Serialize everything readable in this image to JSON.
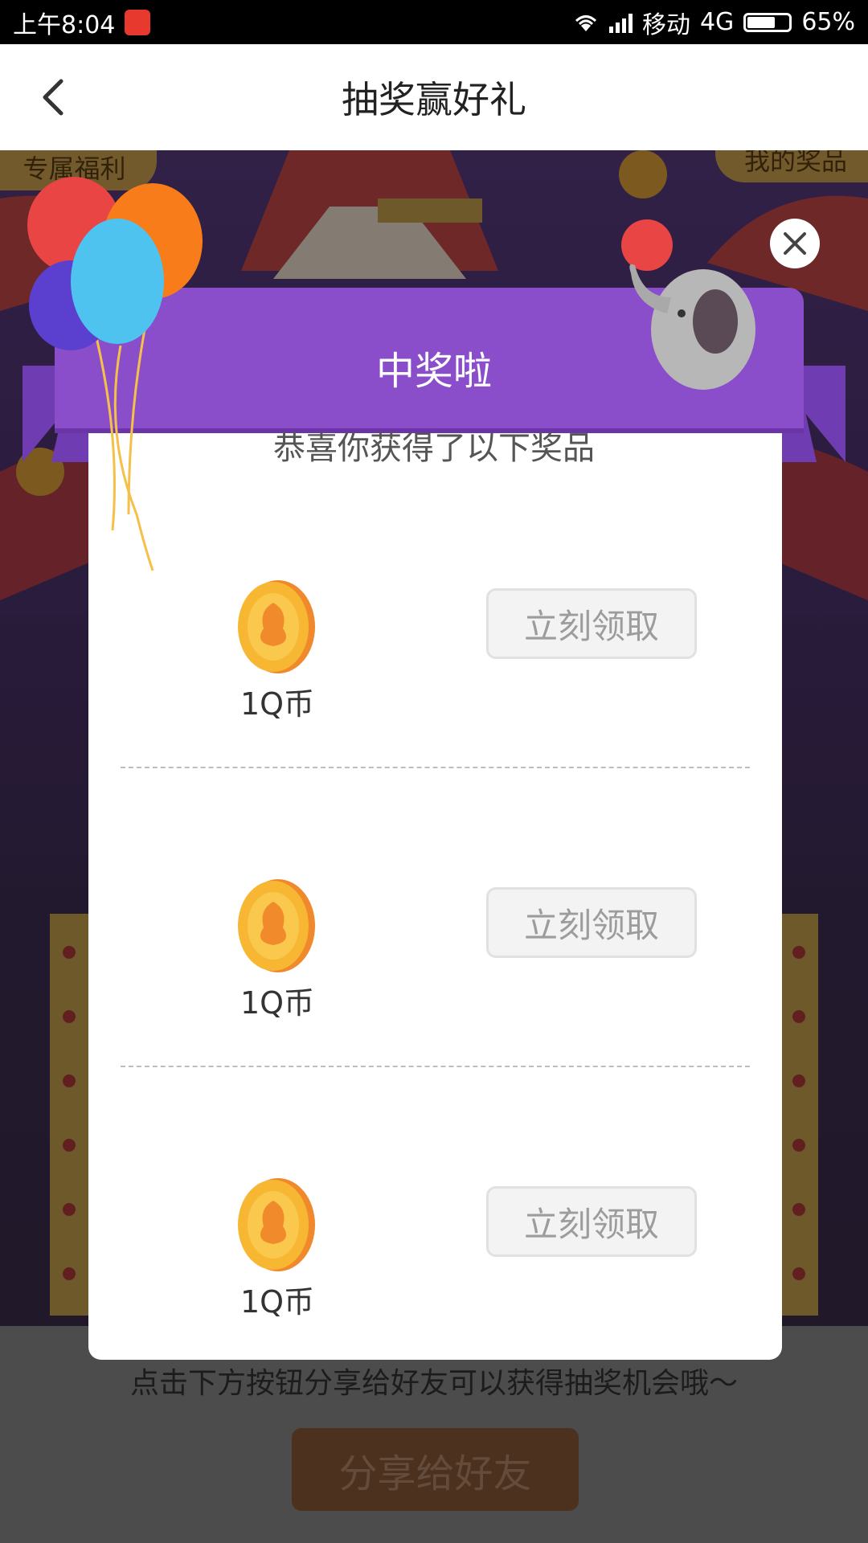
{
  "status_bar": {
    "time": "上午8:04",
    "carrier": "移动",
    "network": "4G",
    "battery": "65%",
    "battery_level": 0.65
  },
  "header": {
    "title": "抽奖赢好礼",
    "back_icon": "chevron-left-icon"
  },
  "background": {
    "left_tag": "专属福利",
    "right_tag": "我的奖品",
    "hint_text": "点击下方按钮分享给好友可以获得抽奖机会哦～",
    "share_button": "分享给好友"
  },
  "modal": {
    "banner_title": "中奖啦",
    "subtitle": "恭喜你获得了以下奖品",
    "close_icon": "close-icon",
    "prizes": [
      {
        "name": "1Q币",
        "button": "立刻领取"
      },
      {
        "name": "1Q币",
        "button": "立刻领取"
      },
      {
        "name": "1Q币",
        "button": "立刻领取"
      }
    ]
  },
  "colors": {
    "banner": "#8b4ecb",
    "coin": "#f7b733",
    "share_button": "#8a5a38"
  }
}
